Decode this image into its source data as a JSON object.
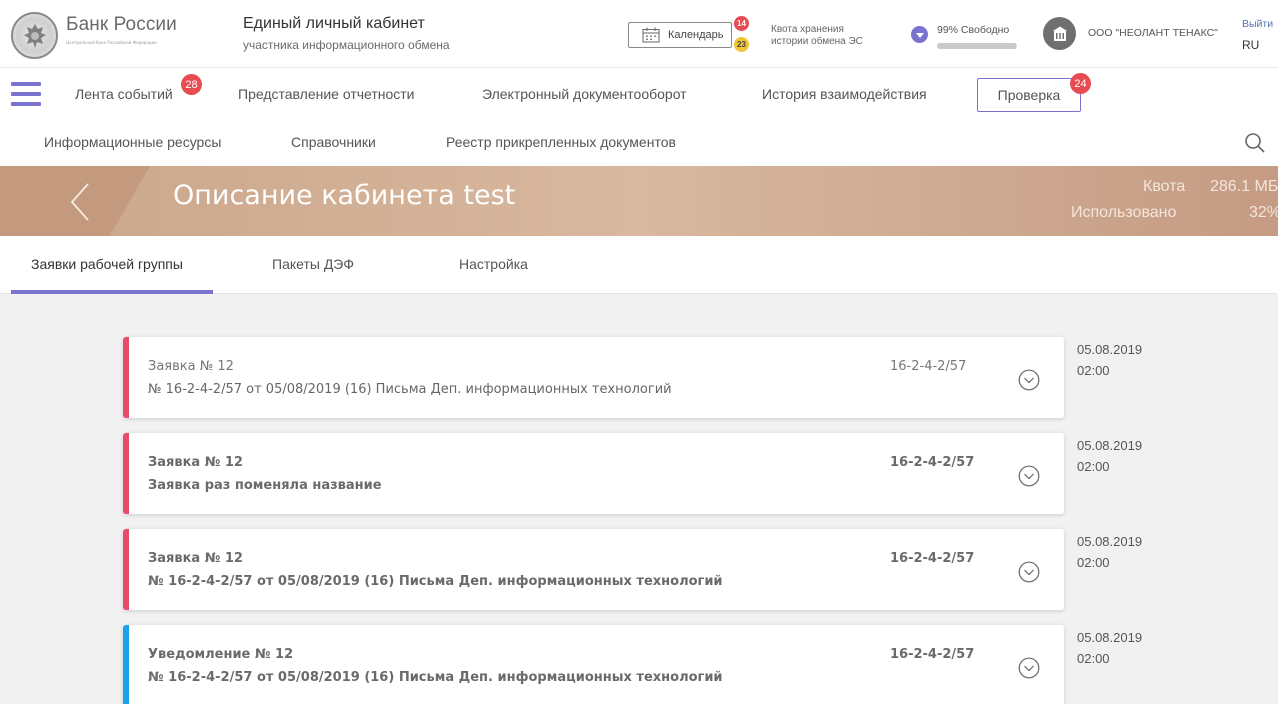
{
  "header": {
    "bank_name": "Банк России",
    "bank_sub": "Центральный банк Российской Федерации",
    "cabinet_title": "Единый личный кабинет",
    "cabinet_sub": "участника информационного обмена",
    "calendar_label": "Календарь",
    "calendar_badge_red": "14",
    "calendar_badge_yellow": "23",
    "quota_label_line1": "Квота хранения",
    "quota_label_line2": "истории обмена ЭС",
    "free_label": "99% Свободно",
    "free_percent": 99,
    "org_name": "ООО \"НЕОЛАНТ ТЕНАКС\"",
    "logout": "Выйти",
    "lang": "RU"
  },
  "nav": {
    "feed": "Лента событий",
    "feed_badge": "28",
    "reporting": "Представление отчетности",
    "edo": "Электронный документооборот",
    "history": "История взаимодействия",
    "check": "Проверка",
    "check_badge": "24",
    "resources": "Информационные ресурсы",
    "directories": "Справочники",
    "registry": "Реестр прикрепленных документов"
  },
  "banner": {
    "title": "Описание кабинета test",
    "quota_label": "Квота",
    "quota_value": "286.1 МБ",
    "used_label": "Использовано",
    "used_value": "32%"
  },
  "tabs": {
    "requests": "Заявки рабочей группы",
    "packages": "Пакеты ДЭФ",
    "settings": "Настройка"
  },
  "colors": {
    "accent": "#7a72cf",
    "stripe_red": "#e84b6a",
    "stripe_blue": "#1aa3ea"
  },
  "cards": [
    {
      "title": "Заявка  № 12",
      "desc": "№ 16-2-4-2/57 от 05/08/2019 (16) Письма Деп. информационных технологий",
      "number": "16-2-4-2/57",
      "date": "05.08.2019",
      "time": "02:00"
    },
    {
      "title": "Заявка  № 12",
      "desc": "Заявка раз поменяла название",
      "number": "16-2-4-2/57",
      "date": "05.08.2019",
      "time": "02:00"
    },
    {
      "title": "Заявка  № 12",
      "desc": "№ 16-2-4-2/57 от 05/08/2019 (16) Письма Деп. информационных технологий",
      "number": "16-2-4-2/57",
      "date": "05.08.2019",
      "time": "02:00"
    },
    {
      "title": "Уведомление  № 12",
      "desc": "№ 16-2-4-2/57 от 05/08/2019 (16) Письма Деп. информационных технологий",
      "number": "16-2-4-2/57",
      "date": "05.08.2019",
      "time": "02:00"
    }
  ]
}
